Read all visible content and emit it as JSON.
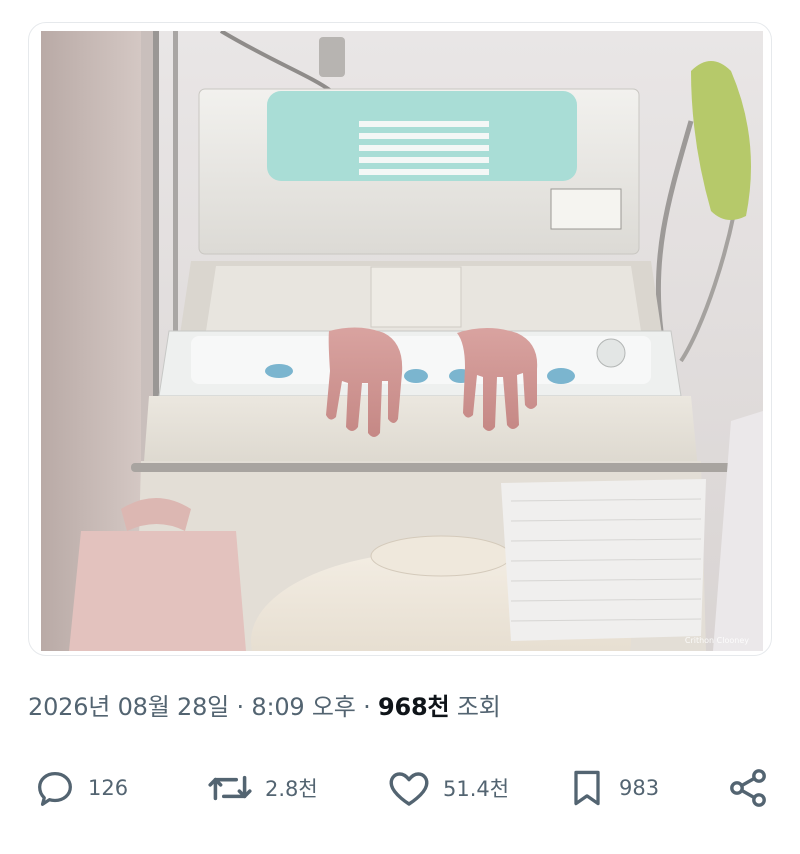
{
  "post": {
    "image_watermark": "Crithon Clooney",
    "meta": {
      "date": "2026년 08월 28일",
      "separator": "·",
      "time": "8:09 오후",
      "views_count": "968천",
      "views_label": "조회"
    },
    "actions": {
      "replies": "126",
      "reposts": "2.8천",
      "likes": "51.4천",
      "bookmarks": "983"
    },
    "icons": [
      "reply-icon",
      "repost-icon",
      "like-icon",
      "bookmark-icon",
      "share-icon"
    ]
  },
  "colors": {
    "text_secondary": "#536471",
    "text_primary": "#0f1419",
    "border": "#e6e9ec"
  }
}
